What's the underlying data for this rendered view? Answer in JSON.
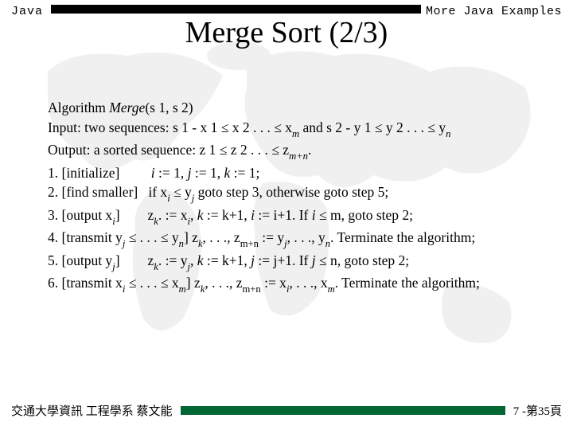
{
  "header": {
    "left": "Java",
    "right": "More Java Examples"
  },
  "title": "Merge Sort (2/3)",
  "algorithm": {
    "name": "Merge",
    "args": "(s 1, s 2)",
    "input_prefix": "Input: two sequences: s 1 - x 1 ",
    "input_mid": " x 2 . . . ",
    "input_xm": " x",
    "input_and": " and s 2 - y 1 ",
    "input_y2": " y 2 . . . ",
    "input_yn": " y",
    "output_prefix": "Output: a sorted sequence: z 1 ",
    "output_z2": " z 2 . . . ",
    "output_zmn": " z",
    "output_dot": ".",
    "step1_label": "1. [initialize]",
    "step1_body": " := 1, ",
    "step1_j": " := 1, ",
    "step1_k": " := 1;",
    "step2_label": "2. [find smaller]",
    "step2_if": "if x",
    "step2_y": " y",
    "step2_goto": " goto step 3, otherwise goto step 5;",
    "step3_label": "3. [output x",
    "step3_close": "]",
    "step3_z": "z",
    "step3_assign": ". := x",
    "step3_k": ", ",
    "step3_kinc": " := k+1, ",
    "step3_iinc": " := i+1. If ",
    "step3_m": " m, goto step 2;",
    "step4_label": "4. [transmit y",
    "step4_dots": " . . . ",
    "step4_yn": " y",
    "step4_close": "] z",
    "step4_comma": ", . . ., z",
    "step4_assign": " := y",
    "step4_yndot": ", . . ., y",
    "step4_term": ". Terminate the algorithm;",
    "step5_label": "5. [output y",
    "step5_close": "]",
    "step5_z": "z",
    "step5_assign": ". := y",
    "step5_k": ", ",
    "step5_kinc": " := k+1, ",
    "step5_jinc": " := j+1. If ",
    "step5_n": " n, goto step 2;",
    "step6_label": "6. [transmit x",
    "step6_dots": " . . . ",
    "step6_xm": " x",
    "step6_close": "] z",
    "step6_comma": ", . . ., z",
    "step6_assign": " := x",
    "step6_xmdot": ", . . ., x",
    "step6_term": ". Terminate the algorithm;",
    "le": "≤",
    "i": "i",
    "j": "j",
    "k": "k",
    "m": "m",
    "n": "n",
    "mn": "m+n"
  },
  "footer": {
    "left": "交通大學資訊 工程學系  蔡文能",
    "right": "7 -第35頁"
  }
}
